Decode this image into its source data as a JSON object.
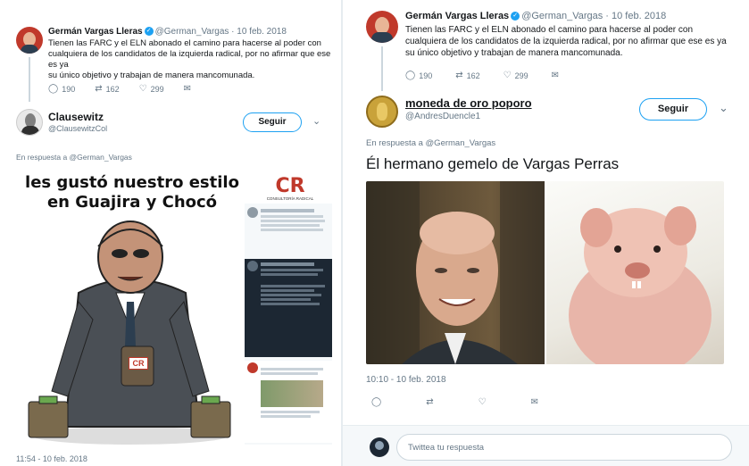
{
  "left": {
    "top_tweet": {
      "name": "Germán Vargas Lleras",
      "handle_date": "@German_Vargas · 10 feb. 2018",
      "text_lines": [
        "Tienen las FARC y el ELN abonado el camino para hacerse al poder con",
        "cualquiera de los candidatos de la izquierda radical, por no afirmar que ese es ya",
        "su único objetivo y trabajan de manera mancomunada."
      ],
      "replies": "190",
      "retweets": "162",
      "likes": "299"
    },
    "reply": {
      "name": "Clausewitz",
      "handle": "@ClausewitzCol",
      "follow_label": "Seguir",
      "reply_to": "En respuesta a @German_Vargas",
      "timestamp": "11:54 - 10 feb. 2018",
      "cartoon": {
        "caption": "les gustó nuestro estilo en Guajira y Chocó",
        "logo_mark": "CR",
        "logo_text": "CONSULTORÍA RADICAL",
        "bag_logo": "CR"
      }
    }
  },
  "right": {
    "top_tweet": {
      "name": "Germán Vargas Lleras",
      "handle_date": "@German_Vargas · 10 feb. 2018",
      "text_lines": [
        "Tienen las FARC y el ELN abonado el camino para hacerse al poder con",
        "cualquiera de los candidatos de la izquierda radical, por no afirmar que ese es ya",
        "su único objetivo y trabajan de manera mancomunada."
      ],
      "replies": "190",
      "retweets": "162",
      "likes": "299"
    },
    "reply": {
      "name": "moneda de oro poporo",
      "handle": "@AndresDuencle1",
      "follow_label": "Seguir",
      "reply_to": "En respuesta a @German_Vargas",
      "text": "Él hermano gemelo de Vargas Perras",
      "timestamp": "10:10 - 10 feb. 2018"
    },
    "reply_placeholder": "Twittea tu respuesta"
  },
  "icons": {
    "reply": "reply-icon",
    "retweet": "retweet-icon",
    "like": "heart-icon",
    "dm": "envelope-icon",
    "chevron": "chevron-down-icon",
    "verified": "verified-badge-icon"
  },
  "colors": {
    "accent": "#1da1f2",
    "muted": "#657786",
    "text": "#14171a"
  }
}
